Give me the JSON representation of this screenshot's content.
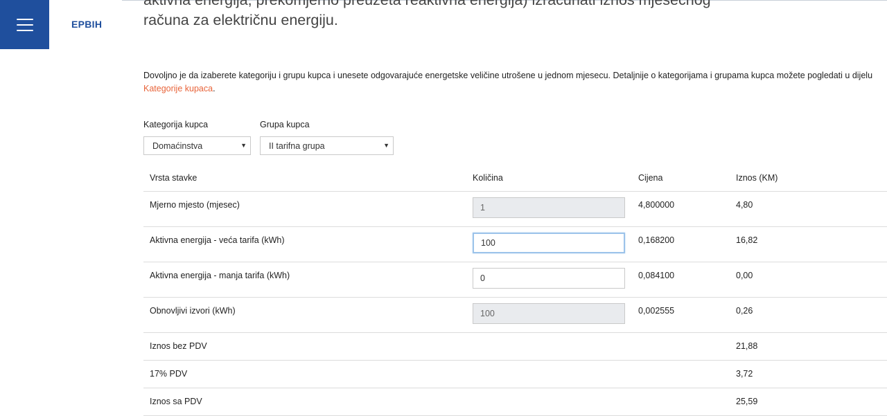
{
  "brand": "EPBIH",
  "heading_lines": [
    "aktivna energija, prekomjerno preuzeta reaktivna energija) izračunati iznos mjesečnog",
    "računa za električnu energiju."
  ],
  "intro": {
    "text": "Dovoljno je da izaberete kategoriju i grupu kupca i unesete odgovarajuće energetske veličine utrošene u jednom mjesecu. Detaljnije o kategorijama i grupama kupca možete pogledati u dijelu",
    "link": "Kategorije kupaca",
    "after": "."
  },
  "filters": {
    "category_label": "Kategorija kupca",
    "category_value": "Domaćinstva",
    "group_label": "Grupa kupca",
    "group_value": "II tarifna grupa"
  },
  "table": {
    "headers": [
      "Vrsta stavke",
      "Količina",
      "Cijena",
      "Iznos (KM)"
    ],
    "items": [
      {
        "label": "Mjerno mjesto (mjesec)",
        "qty": "1",
        "price": "4,800000",
        "amount": "4,80"
      },
      {
        "label": "Aktivna energija - veća tarifa (kWh)",
        "qty": "100",
        "price": "0,168200",
        "amount": "16,82"
      },
      {
        "label": "Aktivna energija - manja tarifa (kWh)",
        "qty": "0",
        "price": "0,084100",
        "amount": "0,00"
      },
      {
        "label": "Obnovljivi izvori (kWh)",
        "qty": "100",
        "price": "0,002555",
        "amount": "0,26"
      }
    ],
    "totals": [
      {
        "label": "Iznos bez PDV",
        "amount": "21,88"
      },
      {
        "label": "17% PDV",
        "amount": "3,72"
      },
      {
        "label": "Iznos sa PDV",
        "amount": "25,59"
      }
    ]
  },
  "colors": {
    "brand_blue": "#1f4f9d",
    "link_orange": "#e8643a"
  },
  "icons": {
    "menu": "hamburger-menu-icon",
    "select_arrow": "caret-down-icon"
  }
}
